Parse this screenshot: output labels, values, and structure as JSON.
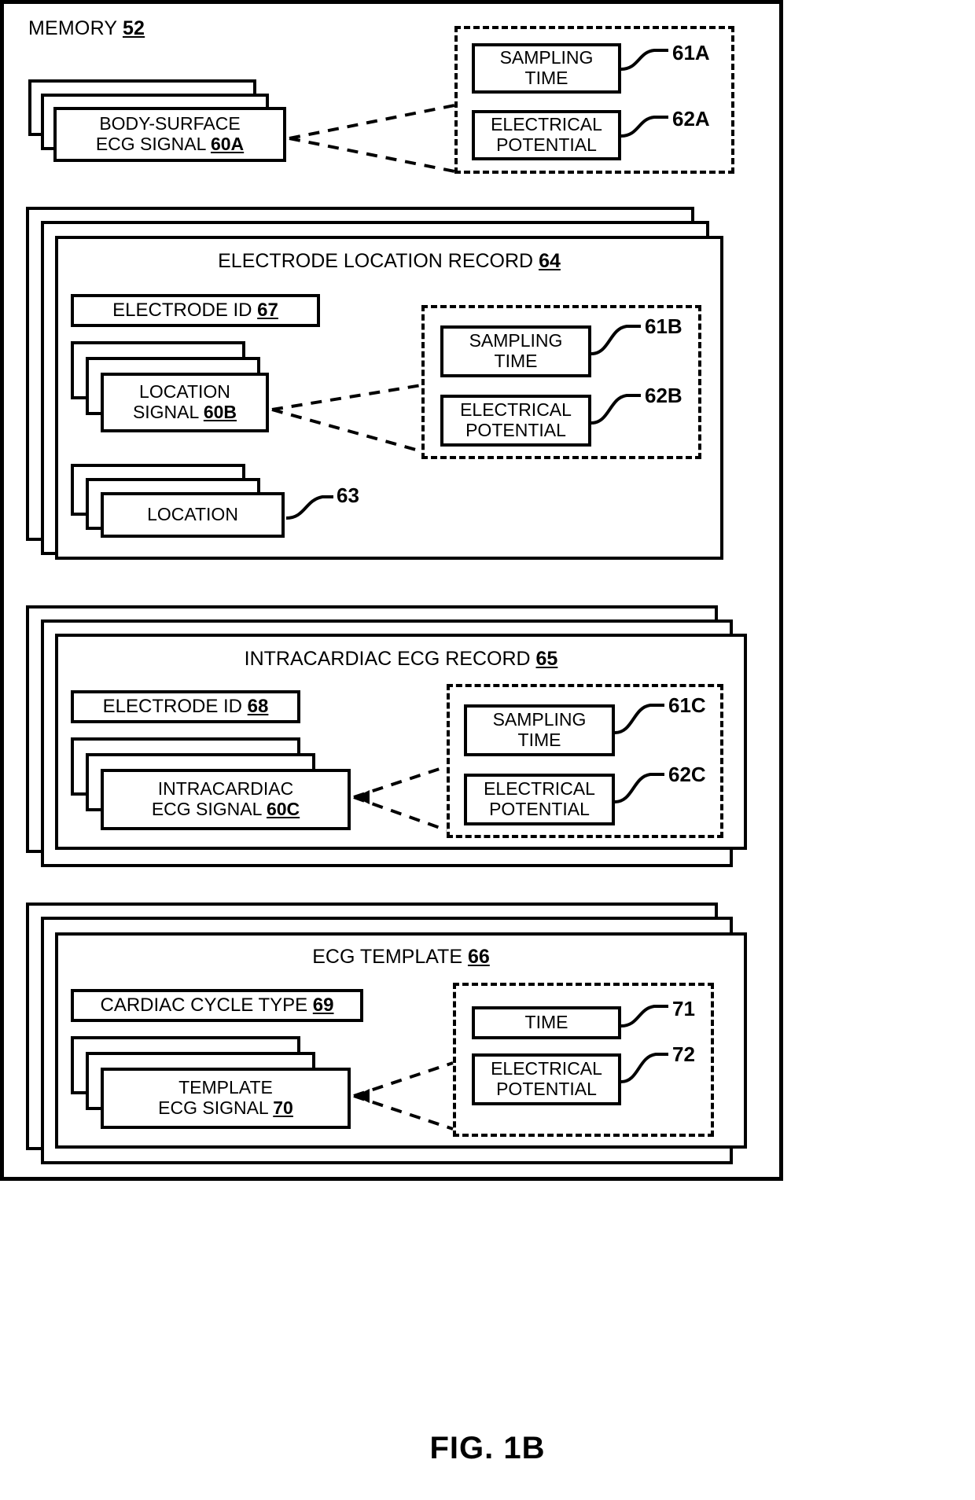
{
  "figure": {
    "caption": "FIG. 1B"
  },
  "memory": {
    "label": "MEMORY",
    "ref": "52"
  },
  "body_surface": {
    "signal_line1": "BODY-SURFACE",
    "signal_line2": "ECG SIGNAL",
    "signal_ref": "60A",
    "attributes": {
      "sampling_time_line1": "SAMPLING",
      "sampling_time_line2": "TIME",
      "sampling_time_ref": "61A",
      "electrical_potential_line1": "ELECTRICAL",
      "electrical_potential_line2": "POTENTIAL",
      "electrical_potential_ref": "62A"
    }
  },
  "electrode_location_record": {
    "title": "ELECTRODE LOCATION RECORD",
    "title_ref": "64",
    "electrode_id_label": "ELECTRODE ID",
    "electrode_id_ref": "67",
    "location_signal_line1": "LOCATION",
    "location_signal_line2": "SIGNAL",
    "location_signal_ref": "60B",
    "location_label": "LOCATION",
    "location_ref": "63",
    "attributes": {
      "sampling_time_line1": "SAMPLING",
      "sampling_time_line2": "TIME",
      "sampling_time_ref": "61B",
      "electrical_potential_line1": "ELECTRICAL",
      "electrical_potential_line2": "POTENTIAL",
      "electrical_potential_ref": "62B"
    }
  },
  "intracardiac_ecg_record": {
    "title": "INTRACARDIAC ECG RECORD",
    "title_ref": "65",
    "electrode_id_label": "ELECTRODE ID",
    "electrode_id_ref": "68",
    "signal_line1": "INTRACARDIAC",
    "signal_line2": "ECG SIGNAL",
    "signal_ref": "60C",
    "attributes": {
      "sampling_time_line1": "SAMPLING",
      "sampling_time_line2": "TIME",
      "sampling_time_ref": "61C",
      "electrical_potential_line1": "ELECTRICAL",
      "electrical_potential_line2": "POTENTIAL",
      "electrical_potential_ref": "62C"
    }
  },
  "ecg_template": {
    "title": "ECG TEMPLATE",
    "title_ref": "66",
    "cardiac_cycle_type_label": "CARDIAC CYCLE TYPE",
    "cardiac_cycle_type_ref": "69",
    "template_signal_line1": "TEMPLATE",
    "template_signal_line2": "ECG SIGNAL",
    "template_signal_ref": "70",
    "attributes": {
      "time_label": "TIME",
      "time_ref": "71",
      "electrical_potential_line1": "ELECTRICAL",
      "electrical_potential_line2": "POTENTIAL",
      "electrical_potential_ref": "72"
    }
  }
}
